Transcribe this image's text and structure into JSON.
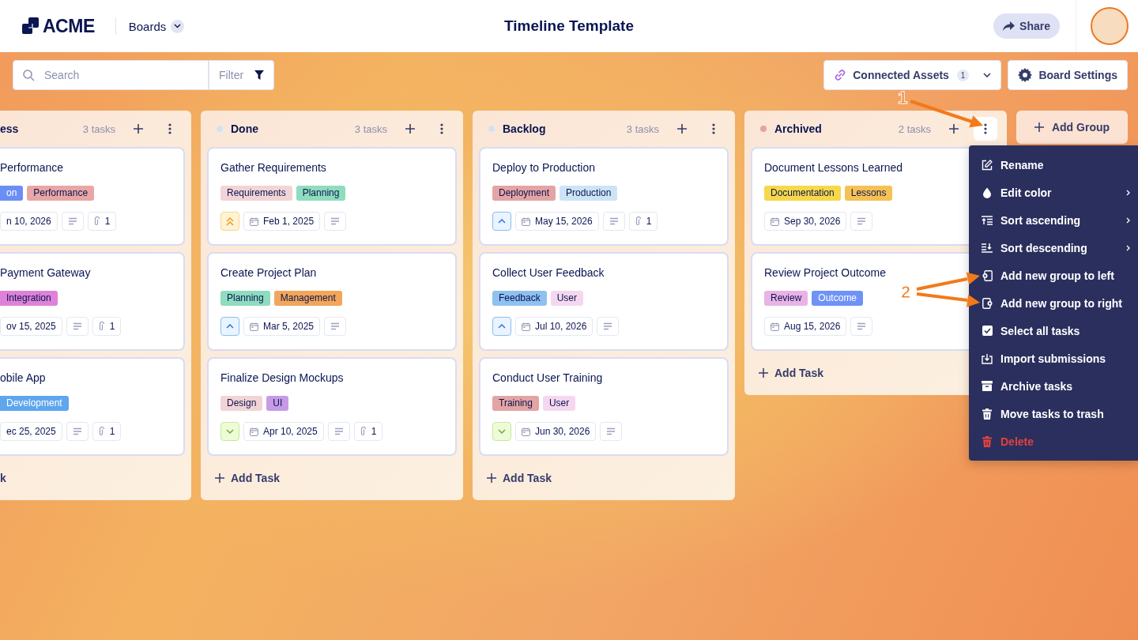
{
  "header": {
    "logo": "ACME",
    "nav": "Boards",
    "title": "Timeline Template",
    "share": "Share"
  },
  "toolbar": {
    "search": {
      "placeholder": "Search"
    },
    "filter": "Filter",
    "connected_assets": {
      "label": "Connected Assets",
      "count": "1"
    },
    "board_settings": "Board Settings"
  },
  "groups": [
    {
      "name": "ess",
      "count": "3 tasks",
      "menu_open": false,
      "cards": [
        {
          "title": "Performance",
          "tags": [
            {
              "label": "on",
              "color": "#6b8ef5"
            },
            {
              "label": "Performance",
              "color": "#e8a6a6"
            }
          ],
          "date": "n 10, 2026",
          "attachments": "1"
        },
        {
          "title": "Payment Gateway",
          "tags": [
            {
              "label": "Integration",
              "color": "#de82d8"
            }
          ],
          "date": "ov 15, 2025",
          "attachments": "1"
        },
        {
          "title": "obile App",
          "tags": [
            {
              "label": "Development",
              "color": "#5ea6ee"
            }
          ],
          "date": "ec 25, 2025",
          "attachments": "1"
        }
      ],
      "add_task": "k"
    },
    {
      "name": "Done",
      "count": "3 tasks",
      "color": "#cfe3f7",
      "menu_open": false,
      "cards": [
        {
          "title": "Gather Requirements",
          "tags": [
            {
              "label": "Requirements",
              "color": "#f2d4d6"
            },
            {
              "label": "Planning",
              "color": "#8fdcbe"
            }
          ],
          "priority": {
            "kind": "high"
          },
          "date": "Feb 1, 2025"
        },
        {
          "title": "Create Project Plan",
          "tags": [
            {
              "label": "Planning",
              "color": "#8fdcbe"
            },
            {
              "label": "Management",
              "color": "#f2a65a"
            }
          ],
          "priority": {
            "kind": "medium"
          },
          "date": "Mar 5, 2025"
        },
        {
          "title": "Finalize Design Mockups",
          "tags": [
            {
              "label": "Design",
              "color": "#f2d4d6"
            },
            {
              "label": "UI",
              "color": "#c69be6"
            }
          ],
          "priority": {
            "kind": "low"
          },
          "date": "Apr 10, 2025",
          "attachments": "1"
        }
      ],
      "add_task": "Add Task"
    },
    {
      "name": "Backlog",
      "count": "3 tasks",
      "color": "#cfe3f7",
      "menu_open": false,
      "cards": [
        {
          "title": "Deploy to Production",
          "tags": [
            {
              "label": "Deployment",
              "color": "#e3a4a4"
            },
            {
              "label": "Production",
              "color": "#cde3f7"
            }
          ],
          "priority": {
            "kind": "medium"
          },
          "date": "May 15, 2026",
          "attachments": "1"
        },
        {
          "title": "Collect User Feedback",
          "tags": [
            {
              "label": "Feedback",
              "color": "#8fc1f0"
            },
            {
              "label": "User",
              "color": "#f5d8f0"
            }
          ],
          "priority": {
            "kind": "medium"
          },
          "date": "Jul 10, 2026"
        },
        {
          "title": "Conduct User Training",
          "tags": [
            {
              "label": "Training",
              "color": "#e3a4a4"
            },
            {
              "label": "User",
              "color": "#f5d8f0"
            }
          ],
          "priority": {
            "kind": "low"
          },
          "date": "Jun 30, 2026"
        }
      ],
      "add_task": "Add Task"
    },
    {
      "name": "Archived",
      "count": "2 tasks",
      "color": "#e8a0a4",
      "menu_open": true,
      "cards": [
        {
          "title": "Document Lessons Learned",
          "tags": [
            {
              "label": "Documentation",
              "color": "#f7d84a"
            },
            {
              "label": "Lessons",
              "color": "#f5c155"
            }
          ],
          "date": "Sep 30, 2026"
        },
        {
          "title": "Review Project Outcome",
          "tags": [
            {
              "label": "Review",
              "color": "#e9b3e6"
            },
            {
              "label": "Outcome",
              "color": "#6e93f5"
            }
          ],
          "date": "Aug 15, 2026"
        }
      ],
      "add_task": "Add Task"
    }
  ],
  "add_group": "Add Group",
  "menu": {
    "items": [
      {
        "label": "Rename",
        "submenu": false,
        "kind": "normal"
      },
      {
        "label": "Edit color",
        "submenu": true,
        "kind": "normal"
      },
      {
        "label": "Sort ascending",
        "submenu": true,
        "kind": "normal"
      },
      {
        "label": "Sort descending",
        "submenu": true,
        "kind": "normal"
      },
      {
        "label": "Add new group to left",
        "submenu": false,
        "kind": "normal"
      },
      {
        "label": "Add new group to right",
        "submenu": false,
        "kind": "normal"
      },
      {
        "label": "Select all tasks",
        "submenu": false,
        "kind": "normal"
      },
      {
        "label": "Import submissions",
        "submenu": false,
        "kind": "normal"
      },
      {
        "label": "Archive tasks",
        "submenu": false,
        "kind": "normal"
      },
      {
        "label": "Move tasks to trash",
        "submenu": false,
        "kind": "normal"
      },
      {
        "label": "Delete",
        "submenu": false,
        "kind": "danger"
      }
    ]
  },
  "annotations": [
    {
      "label": "1"
    },
    {
      "label": "2"
    }
  ]
}
